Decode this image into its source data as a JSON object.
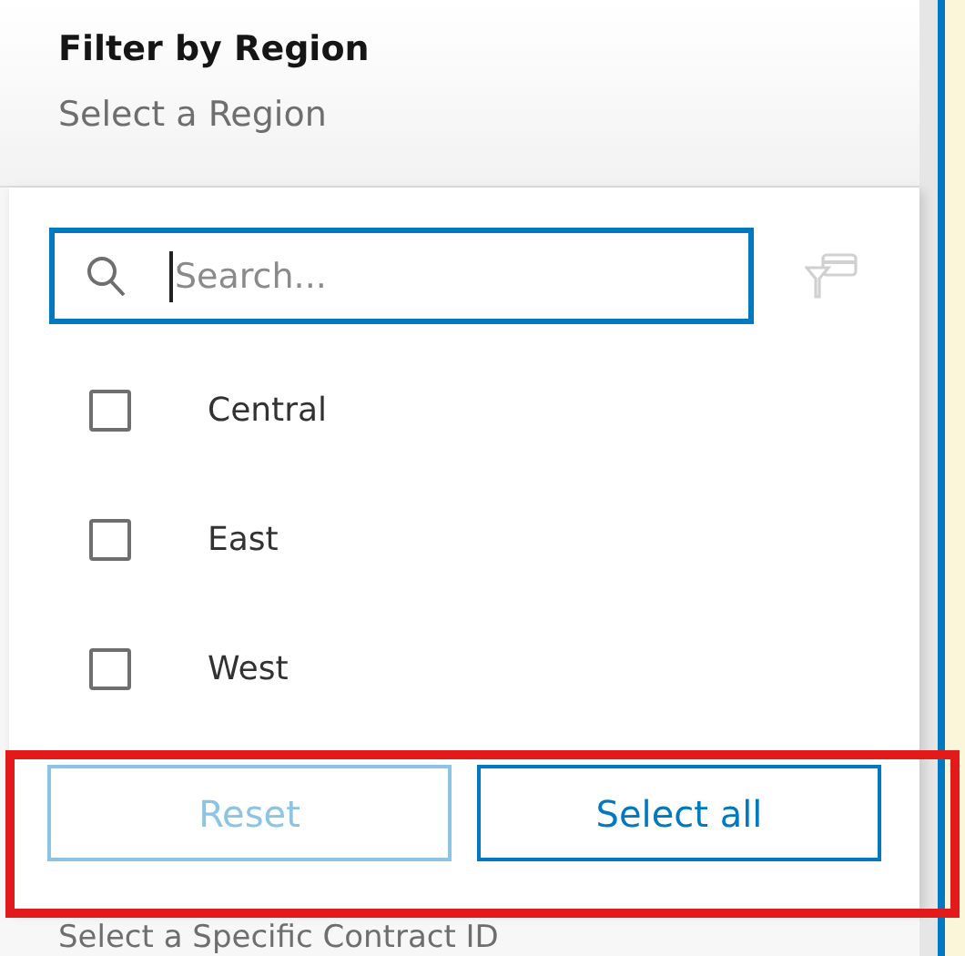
{
  "panel": {
    "title": "Filter by Region",
    "subtitle": "Select a Region"
  },
  "dropdown": {
    "search": {
      "placeholder": "Search..."
    },
    "options": [
      {
        "label": "Central",
        "checked": false
      },
      {
        "label": "East",
        "checked": false
      },
      {
        "label": "West",
        "checked": false
      }
    ],
    "buttons": [
      {
        "label": "Reset",
        "disabled": true
      },
      {
        "label": "Select all",
        "disabled": false
      }
    ]
  },
  "next_field": {
    "placeholder": "Select a Specific Contract ID"
  },
  "highlight": {
    "shown": true
  }
}
